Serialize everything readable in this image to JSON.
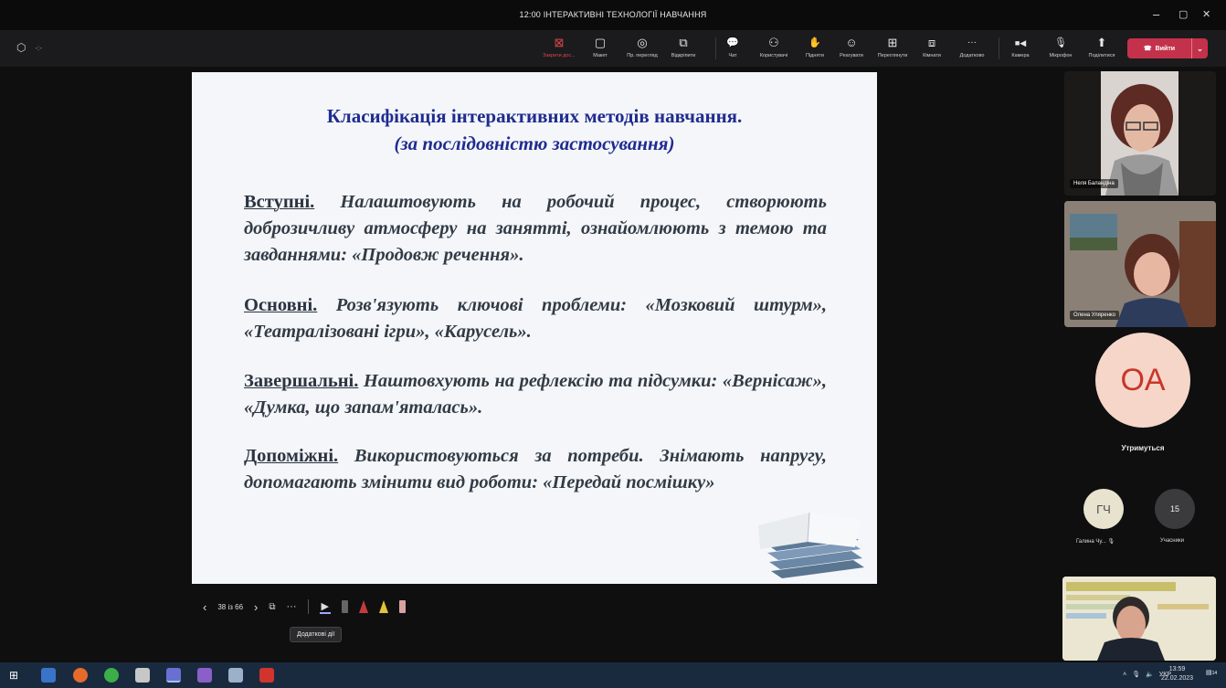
{
  "window": {
    "title": "12:00 ІНТЕРАКТИВНІ ТЕХНОЛОГІЇ НАВЧАННЯ",
    "minimize": "–",
    "maximize": "▢",
    "close": "✕"
  },
  "toolbar": {
    "left_status": "-:-",
    "items": [
      {
        "label": "Закрити дос...",
        "icon": "close-share-icon",
        "glyph": "⊠"
      },
      {
        "label": "Макет",
        "icon": "layout-icon",
        "glyph": "▢"
      },
      {
        "label": "Пр. перегляд",
        "icon": "eye-icon",
        "glyph": "◎"
      },
      {
        "label": "Відкріпити",
        "icon": "pop-out-icon",
        "glyph": "⧉"
      },
      {
        "label": "Чат",
        "icon": "chat-icon",
        "glyph": "💬"
      },
      {
        "label": "Користувачі",
        "icon": "people-icon",
        "glyph": "⚇"
      },
      {
        "label": "Підняти",
        "icon": "raise-hand-icon",
        "glyph": "✋"
      },
      {
        "label": "Реагувати",
        "icon": "react-icon",
        "glyph": "☺"
      },
      {
        "label": "Переглянути",
        "icon": "view-icon",
        "glyph": "⊞"
      },
      {
        "label": "Кімнати",
        "icon": "rooms-icon",
        "glyph": "⧈"
      },
      {
        "label": "Додатково",
        "icon": "more-icon",
        "glyph": "···"
      },
      {
        "label": "Камера",
        "icon": "camera-icon",
        "glyph": "■◀"
      },
      {
        "label": "Мікрофон",
        "icon": "microphone-icon",
        "glyph": "🎙"
      },
      {
        "label": "Поділитися",
        "icon": "share-icon",
        "glyph": "⬆"
      }
    ],
    "leave_label": "Вийти",
    "leave_color": "#c4314b"
  },
  "slide": {
    "title": "Класифікація інтерактивних методів навчання.",
    "subtitle": "(за послідовністю застосування)",
    "paragraphs": [
      {
        "lead": "Вступні.",
        "text": " Налаштовують на робочий процес, створюють доброзичливу атмосферу на занятті, ознайомлюють з темою та завданнями: «Продовж речення»."
      },
      {
        "lead": "Основні.",
        "text": " Розв'язують ключові проблеми: «Мозковий штурм», «Театралізовані ігри», «Карусель»."
      },
      {
        "lead": "Завершальні.",
        "text": " Наштовхують на рефлексію та підсумки: «Вернісаж», «Думка, що запам'яталась»."
      },
      {
        "lead": "Допоміжні.",
        "text": " Використовуються за потреби. Знімають напругу, допомагають змінити вид роботи: «Передай посмішку»"
      }
    ]
  },
  "slide_controls": {
    "page": "38 із 66",
    "tooltip": "Додаткові дії"
  },
  "participants": {
    "video1_name": "Неля Баландіна",
    "video2_name": "Олена Уляренко",
    "big_avatar_initials": "OA",
    "big_avatar_name": "Утримуться",
    "small_avatar_initials": "ГЧ",
    "small_avatar_name": "Галина Чу...",
    "count": "15",
    "count_label": "Учасники"
  },
  "taskbar": {
    "lang": "УКР",
    "time": "13:59",
    "date": "22.02.2023",
    "notif_count": "14"
  }
}
